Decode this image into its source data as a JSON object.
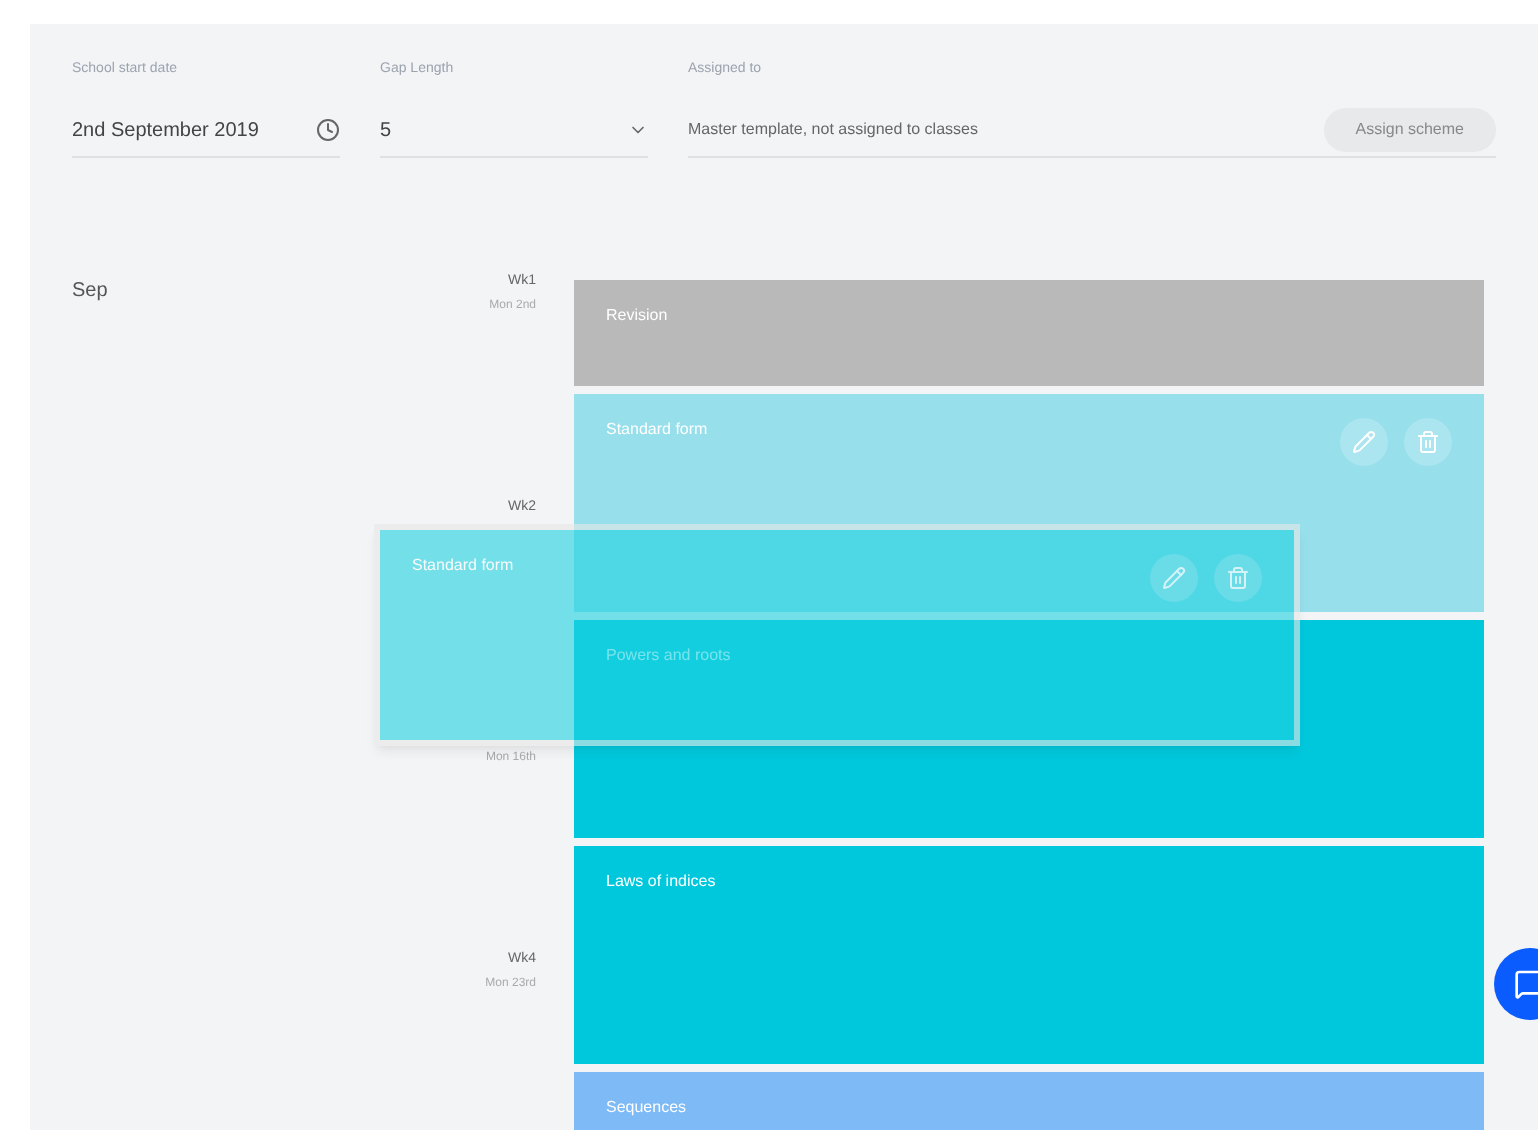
{
  "fields": [
    {
      "label": "School start date",
      "value": "2nd September 2019",
      "kind": "date"
    },
    {
      "label": "Gap Length",
      "value": "5",
      "kind": "select"
    },
    {
      "label": "Assigned to",
      "value": "Master template, not assigned to classes",
      "kind": "text"
    }
  ],
  "assign_button": "Assign scheme",
  "month": "Sep",
  "weeks": [
    {
      "label": "Wk1",
      "date": "Mon 2nd"
    },
    {
      "label": "Wk2"
    },
    {
      "date": "Mon 16th"
    },
    {
      "label": "Wk4",
      "date": "Mon 23rd"
    }
  ],
  "blocks": [
    {
      "title": "Revision",
      "color": "#b9b9b9",
      "kind": "short",
      "show_actions": false
    },
    {
      "title": "Standard form",
      "color": "#97dfeb",
      "kind": "full",
      "show_actions": true
    },
    {
      "title": "Powers and roots",
      "color": "#00c8dc",
      "kind": "full",
      "show_actions": false
    },
    {
      "title": "Laws of indices",
      "color": "#00c8dc",
      "kind": "full",
      "show_actions": false
    },
    {
      "title": "Sequences",
      "color": "#7dbaf6",
      "kind": "full",
      "show_actions": false
    }
  ],
  "dragging": {
    "title": "Standard form",
    "color": "#1fd2e2"
  }
}
